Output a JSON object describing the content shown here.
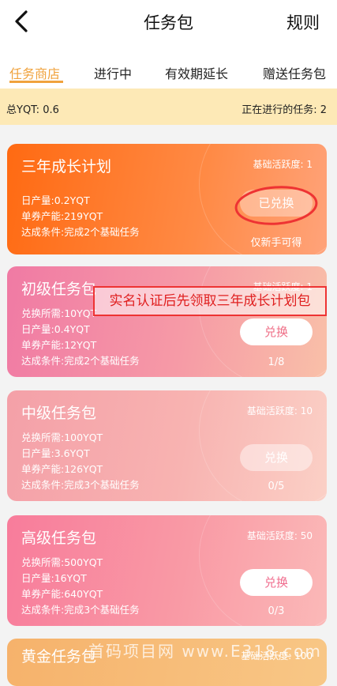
{
  "header": {
    "title": "任务包",
    "rules_label": "规则"
  },
  "tabs": [
    {
      "label": "任务商店",
      "active": true
    },
    {
      "label": "进行中"
    },
    {
      "label": "有效期延长"
    },
    {
      "label": "赠送任务包"
    }
  ],
  "summary": {
    "total": "总YQT: 0.6",
    "running": "正在进行的任务: 2"
  },
  "cards": [
    {
      "name": "三年成长计划",
      "activity": "基础活跃度: 1",
      "lines": [
        "日产量:0.2YQT",
        "单券产能:219YQT",
        "达成条件:完成2个基础任务"
      ],
      "button": "已兑换",
      "footer": "仅新手可得"
    },
    {
      "name": "初级任务包",
      "activity": "基础活跃度: 1",
      "lines": [
        "兑换所需:10YQT",
        "日产量:0.4YQT",
        "单券产能:12YQT",
        "达成条件:完成2个基础任务"
      ],
      "button": "兑换",
      "footer": "1/8"
    },
    {
      "name": "中级任务包",
      "activity": "基础活跃度: 10",
      "lines": [
        "兑换所需:100YQT",
        "日产量:3.6YQT",
        "单券产能:126YQT",
        "达成条件:完成3个基础任务"
      ],
      "button": "兑换",
      "footer": "0/5"
    },
    {
      "name": "高级任务包",
      "activity": "基础活跃度: 50",
      "lines": [
        "兑换所需:500YQT",
        "日产量:16YQT",
        "单券产能:640YQT",
        "达成条件:完成3个基础任务"
      ],
      "button": "兑换",
      "footer": "0/3"
    },
    {
      "name": "黄金任务包",
      "activity": "基础活跃度: 100"
    }
  ],
  "annotation": "实名认证后先领取三年成长计划包",
  "watermark": "首码项目网 www.E318.com",
  "colors": {
    "accent": "#f0a23c",
    "summary_bg": "#fde9b6",
    "annotation_red": "#e33"
  }
}
